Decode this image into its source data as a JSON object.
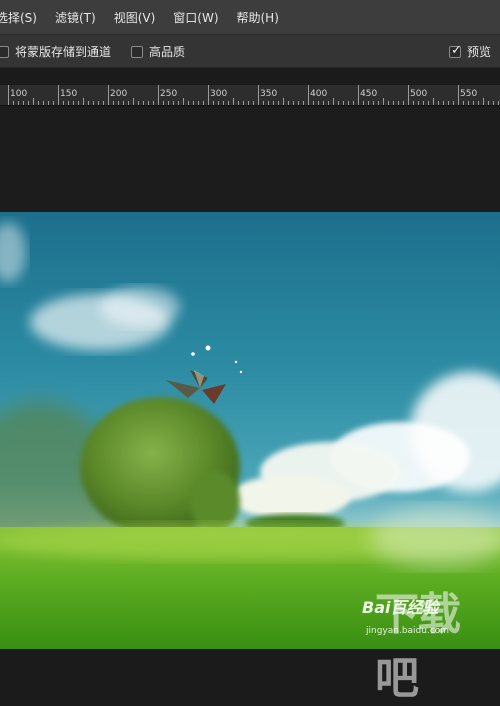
{
  "menu": {
    "items": [
      {
        "id": "select",
        "label": "选择(S)"
      },
      {
        "id": "filter",
        "label": "滤镜(T)"
      },
      {
        "id": "view",
        "label": "视图(V)"
      },
      {
        "id": "window",
        "label": "窗口(W)"
      },
      {
        "id": "help",
        "label": "帮助(H)"
      }
    ]
  },
  "options": {
    "save_mask_label": "将蒙版存储到通道",
    "save_mask_checked": false,
    "high_quality_label": "高品质",
    "high_quality_checked": false,
    "preview_label": "预览",
    "preview_checked": true
  },
  "ruler": {
    "labels": [
      "100",
      "150",
      "200",
      "250",
      "300",
      "350",
      "400",
      "450",
      "500",
      "550"
    ]
  },
  "watermark": {
    "site_cn": "下载吧",
    "logo": "Bai百经验",
    "url": "jingyan.baidu.com"
  },
  "colors": {
    "menubar_bg": "#3d3d3d",
    "optionsbar_bg": "#343434",
    "ruler_bg": "#2d2d2d",
    "workspace_bg": "#1c1c1c"
  }
}
